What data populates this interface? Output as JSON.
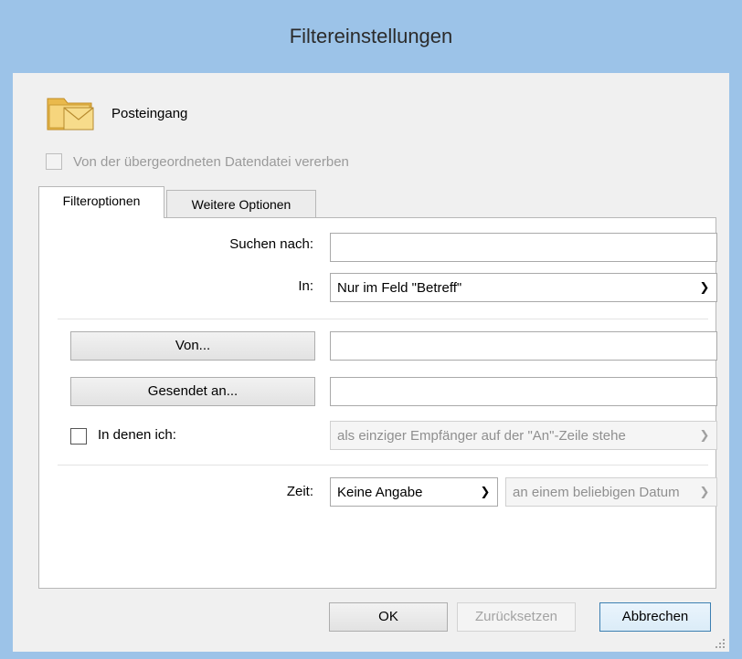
{
  "window": {
    "title": "Filtereinstellungen"
  },
  "folder": {
    "name": "Posteingang",
    "icon": "mail-folder-icon"
  },
  "inherit": {
    "label": "Von der übergeordneten Datendatei vererben",
    "checked": false,
    "enabled": false
  },
  "tabs": [
    {
      "label": "Filteroptionen",
      "active": true
    },
    {
      "label": "Weitere Optionen",
      "active": false
    }
  ],
  "form": {
    "search_label": "Suchen nach:",
    "search_value": "",
    "in_label": "In:",
    "in_selected": "Nur im Feld \"Betreff\"",
    "from_button": "Von...",
    "from_value": "",
    "sent_to_button": "Gesendet an...",
    "sent_to_value": "",
    "where_i_label": "In denen ich:",
    "where_i_checked": false,
    "where_i_selected": "als einziger Empfänger auf der \"An\"-Zeile stehe",
    "time_label": "Zeit:",
    "time_selected": "Keine Angabe",
    "time_range_selected": "an einem beliebigen Datum"
  },
  "buttons": {
    "ok": "OK",
    "reset": "Zurücksetzen",
    "cancel": "Abbrechen"
  },
  "colors": {
    "frame": "#9cc3e8",
    "client": "#f0f0f0",
    "default_button_border": "#3c7fb1"
  }
}
